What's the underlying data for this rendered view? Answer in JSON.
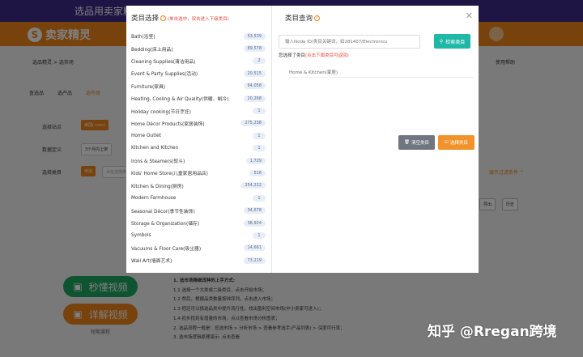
{
  "background": {
    "banner_text": "选品用卖家精灵，",
    "logo_text": "卖家精灵",
    "breadcrumb": "选品精灵 > 选市场",
    "help": "使用帮助",
    "tabs": [
      "查选品",
      "选产品",
      "选市场"
    ],
    "filters": {
      "site_label": "选择站点",
      "site_value": "美国(.com)",
      "data_label": "数据定义",
      "data_value": "3个月内上架",
      "category_label": "选择类目",
      "category_btn": "待选",
      "category_placeholder": "点击选择类目",
      "expand_link": "展示过滤条件 ^"
    },
    "right_buttons": [
      "导出",
      "历史"
    ],
    "video_btn": "秒懂视频",
    "detail_btn": "详解视频",
    "more_link": "短期课程",
    "steps": [
      "1. 选市场精细货种的上手方式:",
      "1.1 选择一个大类或二级类目，点击开始市场；",
      "1.2 然后，根据品类数量按钟序列，点击进入市场；",
      "1.3 把还可以挑选品类中提升流行性，找出盈利空间市场(中小卖家可进入)；",
      "1.4 初步找到有增量的市场，点以查看市场分析图表；",
      "2. 选品流程一般是：挖选市场 > 分析市场 > 查看参考选手(产品列表) > 深度可行率；",
      "3. 选市场逻辑原理演示: 点击查看"
    ],
    "colors": {
      "brand_orange": "#ee8418",
      "banner_purple": "#3e2a8a",
      "video_green": "#1fa862"
    }
  },
  "modal": {
    "left_title": "类目选择",
    "left_hint": "(单击选中，双击进入下级类目)",
    "categories": [
      {
        "name": "Bath(浴室)",
        "count": "53,539"
      },
      {
        "name": "Bedding(床上用品)",
        "count": "89,578"
      },
      {
        "name": "Cleaning Supplies(清洁用品)",
        "count": "2"
      },
      {
        "name": "Event & Party Supplies(活动)",
        "count": "20,515"
      },
      {
        "name": "Furniture(家具)",
        "count": "64,058"
      },
      {
        "name": "Heating, Cooling & Air Quality(供暖、制冷)",
        "count": "20,268"
      },
      {
        "name": "Holiday cooking(节日烹饪)",
        "count": "1"
      },
      {
        "name": "Home Décor Products(家居装饰)",
        "count": "275,238"
      },
      {
        "name": "Home Outlet",
        "count": "1"
      },
      {
        "name": "Kitchen and Kitchen",
        "count": "1"
      },
      {
        "name": "Irons & Steamers(熨斗)",
        "count": "1,729"
      },
      {
        "name": "Kids' Home Store(儿童家居用品店)",
        "count": "516"
      },
      {
        "name": "Kitchen & Dining(厨房)",
        "count": "254,222"
      },
      {
        "name": "Modern Farmhouse",
        "count": "1"
      },
      {
        "name": "Seasonal Décor(季节性装饰)",
        "count": "34,678"
      },
      {
        "name": "Storage & Organization(储存)",
        "count": "38,924"
      },
      {
        "name": "Symbols",
        "count": "1"
      },
      {
        "name": "Vacuums & Floor Care(吸尘器)",
        "count": "14,661"
      },
      {
        "name": "Wall Art(墙面艺术)",
        "count": "73,219"
      }
    ],
    "right_title": "类目查询",
    "search_placeholder": "输入Node ID/类目关键词，如281407/Electronics",
    "search_btn": "检索类目",
    "selected_label": "您选择了类目",
    "selected_hint": "(点击下面类目可返回)",
    "selected_path": "Home & Kitchen(家居)",
    "clear_btn": "清空类目",
    "choose_btn": "选择类目",
    "colors": {
      "search_teal": "#1fb8a6",
      "choose_orange": "#f0932b",
      "hint_red": "#e3483e"
    }
  },
  "watermark": "知乎 @Rregan跨境"
}
